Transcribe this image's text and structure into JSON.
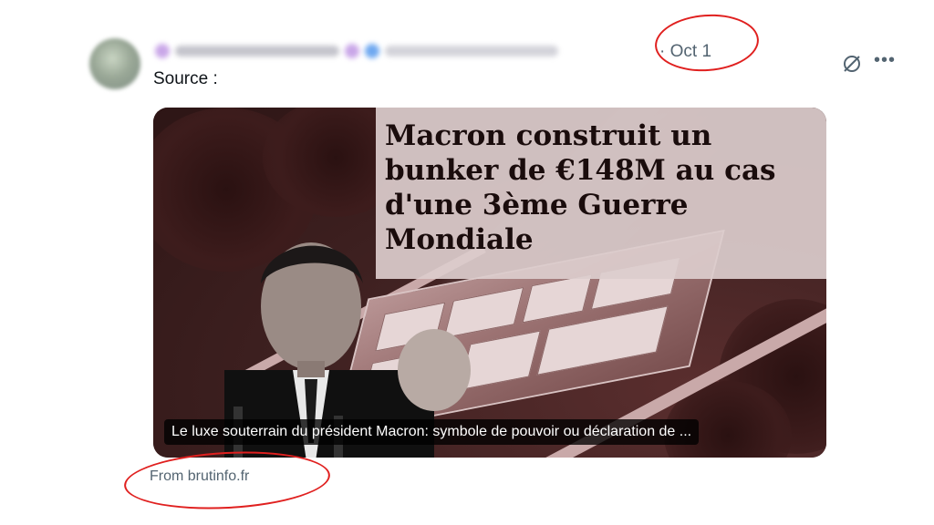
{
  "post": {
    "timestamp": "· Oct 1",
    "text": "Source :",
    "source": "From brutinfo.fr",
    "headline": "Macron construit un bunker de €148M au cas d'une 3ème Guerre Mondiale",
    "caption": "Le luxe souterrain du président Macron: symbole de pouvoir ou déclaration de ..."
  },
  "icons": {
    "grok": "grok-icon",
    "more": "more-icon"
  },
  "colors": {
    "annotation_red": "#e0201f",
    "muted_text": "#536471",
    "primary_text": "#0f1419"
  }
}
